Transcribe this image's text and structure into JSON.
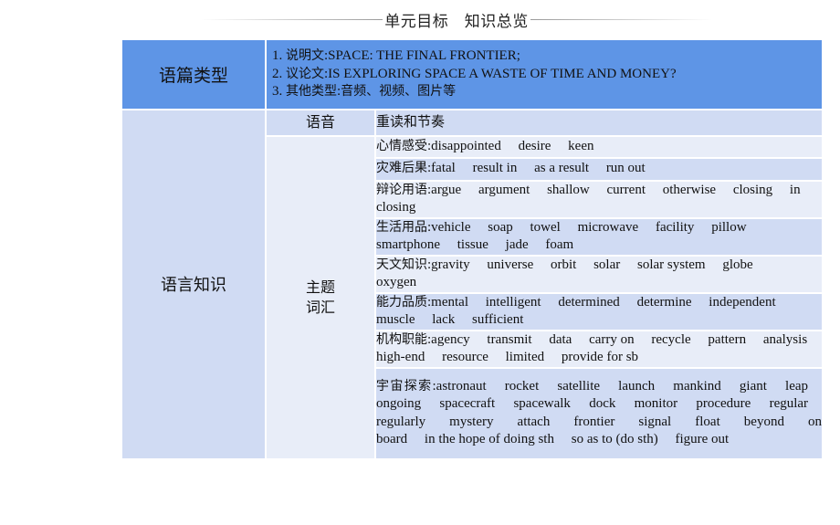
{
  "header": {
    "title": "单元目标　知识总览"
  },
  "text_types": {
    "label": "语篇类型",
    "items": [
      {
        "num": "1. ",
        "cn": "说明文",
        "sep": ":",
        "text": "SPACE: THE FINAL FRONTIER;"
      },
      {
        "num": "2. ",
        "cn": "议论文",
        "sep": ":",
        "text": "IS EXPLORING SPACE A WASTE OF TIME AND MONEY?"
      },
      {
        "num": "3. ",
        "cn": "其他类型",
        "sep": ":",
        "text": "音频、视频、图片等"
      }
    ]
  },
  "language_knowledge": {
    "label": "语言知识",
    "pronunciation": {
      "label": "语音",
      "value": "重读和节奏"
    },
    "vocab_label_line1": "主题",
    "vocab_label_line2": "词汇",
    "vocab_groups": [
      {
        "category": "心情感受",
        "words": [
          "disappointed",
          "desire",
          "keen"
        ]
      },
      {
        "category": "灾难后果",
        "words": [
          "fatal",
          "result in",
          "as a result",
          "run out"
        ]
      },
      {
        "category": "辩论用语",
        "words": [
          "argue",
          "argument",
          "shallow",
          "current",
          "otherwise",
          "closing",
          "in closing"
        ]
      },
      {
        "category": "生活用品",
        "words": [
          "vehicle",
          "soap",
          "towel",
          "microwave",
          "facility",
          "pillow",
          "smartphone",
          "tissue",
          "jade",
          "foam"
        ]
      },
      {
        "category": "天文知识",
        "words": [
          "gravity",
          "universe",
          "orbit",
          "solar",
          "solar system",
          "globe",
          "oxygen"
        ]
      },
      {
        "category": "能力品质",
        "words": [
          "mental",
          "intelligent",
          "determined",
          "determine",
          "independent",
          "muscle",
          "lack",
          "sufficient"
        ]
      },
      {
        "category": "机构职能",
        "words": [
          "agency",
          "transmit",
          "data",
          "carry on",
          "recycle",
          "pattern",
          "analysis",
          "high-end",
          "resource",
          "limited",
          "provide for sb"
        ]
      },
      {
        "category": "宇宙探索",
        "words": [
          "astronaut",
          "rocket",
          "satellite",
          "launch",
          "mankind",
          "giant",
          "leap",
          "ongoing",
          "spacecraft",
          "spacewalk",
          "dock",
          "monitor",
          "procedure",
          "regular",
          "regularly",
          "mystery",
          "attach",
          "frontier",
          "signal",
          "float",
          "beyond",
          "on board",
          "in the hope of doing sth",
          "so as to (do sth)",
          "figure out"
        ]
      }
    ]
  }
}
